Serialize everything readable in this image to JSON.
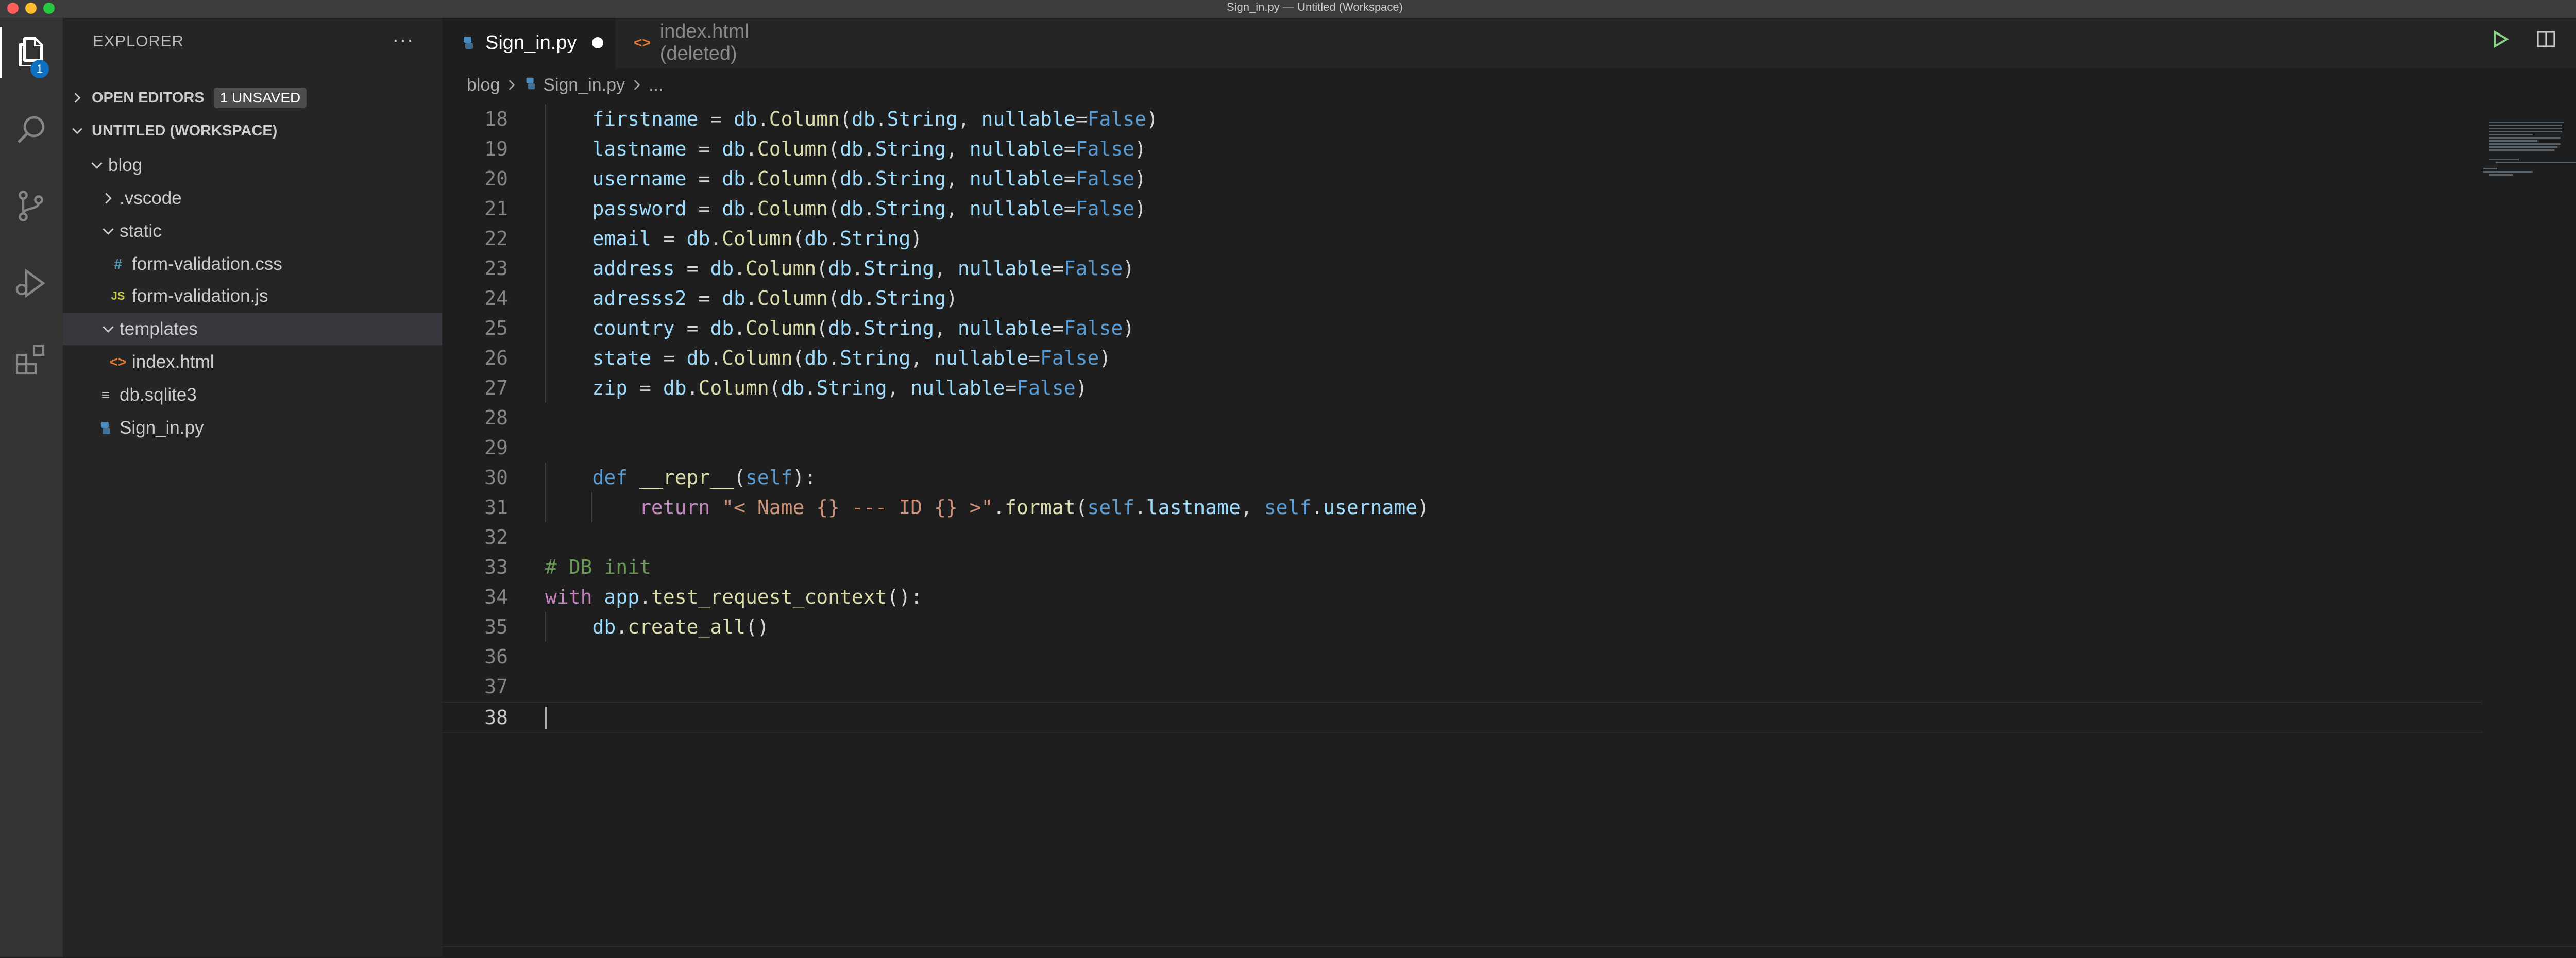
{
  "window": {
    "title": "Sign_in.py — Untitled (Workspace)"
  },
  "activity_bar": {
    "explorer_badge": "1"
  },
  "sidebar": {
    "title": "EXPLORER",
    "more": "···",
    "open_editors": {
      "label": "OPEN EDITORS",
      "badge": "1 UNSAVED"
    },
    "workspace": {
      "label": "UNTITLED (WORKSPACE)"
    },
    "tree": [
      {
        "label": "blog",
        "icon": "folder-open"
      },
      {
        "label": ".vscode",
        "icon": "folder-closed"
      },
      {
        "label": "static",
        "icon": "folder-open"
      },
      {
        "label": "form-validation.css",
        "icon_glyph": "#",
        "icon": "css-file-icon"
      },
      {
        "label": "form-validation.js",
        "icon_glyph": "JS",
        "icon": "js-file-icon"
      },
      {
        "label": "templates",
        "icon": "folder-open"
      },
      {
        "label": "index.html",
        "icon_glyph": "<>",
        "icon": "html-file-icon"
      },
      {
        "label": "db.sqlite3",
        "icon_glyph": "≡",
        "icon": "database-file-icon"
      },
      {
        "label": "Sign_in.py",
        "icon": "python-file-icon"
      }
    ]
  },
  "tabs": [
    {
      "label": "Sign_in.py",
      "icon": "python-file-icon",
      "active": true,
      "dirty": true
    },
    {
      "label": "index.html (deleted)",
      "icon_glyph": "<>",
      "icon": "html-file-icon"
    }
  ],
  "breadcrumb": {
    "folder": "blog",
    "file": "Sign_in.py",
    "rest": "..."
  },
  "code": {
    "line_numbers": [
      "18",
      "19",
      "20",
      "21",
      "22",
      "23",
      "24",
      "25",
      "26",
      "27",
      "28",
      "29",
      "30",
      "31",
      "32",
      "33",
      "34",
      "35",
      "36",
      "37",
      "38"
    ],
    "lines": [
      "    firstname = db.Column(db.String, nullable=False)",
      "    lastname = db.Column(db.String, nullable=False)",
      "    username = db.Column(db.String, nullable=False)",
      "    password = db.Column(db.String, nullable=False)",
      "    email = db.Column(db.String)",
      "    address = db.Column(db.String, nullable=False)",
      "    adresss2 = db.Column(db.String)",
      "    country = db.Column(db.String, nullable=False)",
      "    state = db.Column(db.String, nullable=False)",
      "    zip = db.Column(db.String, nullable=False)",
      "",
      "",
      "    def __repr__(self):",
      "        return \"< Name {} --- ID {} >\".format(self.lastname, self.username)",
      "",
      "# DB init",
      "with app.test_request_context():",
      "    db.create_all()",
      "",
      "",
      ""
    ],
    "current_line": "38"
  },
  "colors": {
    "accent": "#0e70c0",
    "keyword": "#569cd6",
    "control": "#c586c0",
    "function": "#dcdcaa",
    "string": "#ce9178",
    "variable": "#9cdcfe",
    "comment": "#6a9955"
  }
}
